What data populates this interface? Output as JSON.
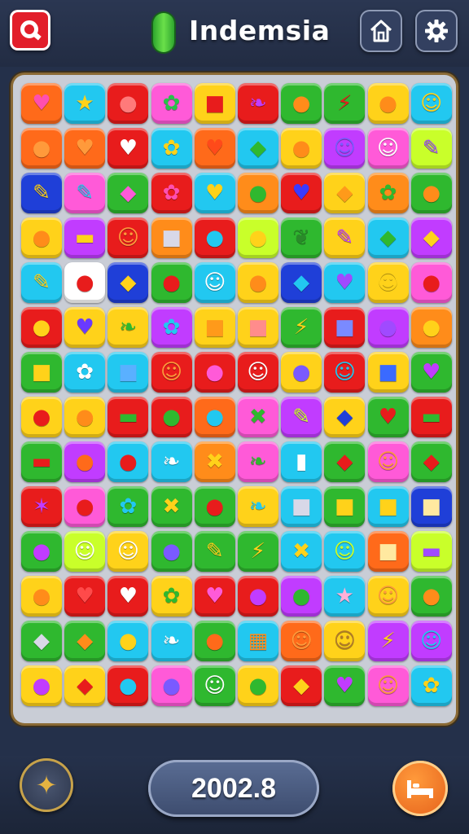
{
  "header": {
    "title": "Indemsia",
    "left_button_icon": "q-badge-icon",
    "pill_icon": "green-pill-icon",
    "home_icon": "home-icon",
    "settings_icon": "gear-icon"
  },
  "board": {
    "columns": 10,
    "rows": 14,
    "tiles": [
      [
        "#ff6a1a",
        "♥",
        "#ff4fb0"
      ],
      [
        "#22c8f0",
        "★",
        "#ffd21a"
      ],
      [
        "#e81c1c",
        "●",
        "#ff7a7a"
      ],
      [
        "#ff5ad8",
        "✿",
        "#29c24a"
      ],
      [
        "#ffd21a",
        "■",
        "#e81c1c"
      ],
      [
        "#e81c1c",
        "❧",
        "#c13cff"
      ],
      [
        "#2fb82f",
        "●",
        "#ff8c1a"
      ],
      [
        "#2fb82f",
        "⚡",
        "#e81c1c"
      ],
      [
        "#ffd21a",
        "●",
        "#ff8c1a"
      ],
      [
        "#22c8f0",
        "☺",
        "#ffd21a"
      ],
      [
        "#ff6a1a",
        "●",
        "#ff9a3b"
      ],
      [
        "#ff6a1a",
        "♥",
        "#ff9a3b"
      ],
      [
        "#e81c1c",
        "♥",
        "#ffffff"
      ],
      [
        "#22c8f0",
        "✿",
        "#ffd21a"
      ],
      [
        "#ff6a1a",
        "♥",
        "#ff4a1a"
      ],
      [
        "#22c8f0",
        "◆",
        "#2fb82f"
      ],
      [
        "#ffd21a",
        "●",
        "#ff8c1a"
      ],
      [
        "#c13cff",
        "☺",
        "#7a5aff"
      ],
      [
        "#ff5ad8",
        "☺",
        "#ffffff"
      ],
      [
        "#c9ff2a",
        "✎",
        "#a04aff"
      ],
      [
        "#1f3fd8",
        "✎",
        "#ffd21a"
      ],
      [
        "#ff5ad8",
        "✎",
        "#22c8f0"
      ],
      [
        "#2fb82f",
        "◆",
        "#ff5ad8"
      ],
      [
        "#e81c1c",
        "✿",
        "#ff4fb0"
      ],
      [
        "#22c8f0",
        "♥",
        "#ffd21a"
      ],
      [
        "#ff8c1a",
        "●",
        "#2fb82f"
      ],
      [
        "#e81c1c",
        "♥",
        "#3a3aff"
      ],
      [
        "#ffd21a",
        "◆",
        "#ff9a1a"
      ],
      [
        "#ff8c1a",
        "✿",
        "#2fb82f"
      ],
      [
        "#2fb82f",
        "●",
        "#ff8c1a"
      ],
      [
        "#ffd21a",
        "●",
        "#ff8c1a"
      ],
      [
        "#c13cff",
        "▬",
        "#ffd21a"
      ],
      [
        "#e81c1c",
        "☺",
        "#ff9a3b"
      ],
      [
        "#ff8c1a",
        "■",
        "#d8d8e8"
      ],
      [
        "#e81c1c",
        "●",
        "#22c8f0"
      ],
      [
        "#c9ff2a",
        "●",
        "#ffd21a"
      ],
      [
        "#2fb82f",
        "❦",
        "#2a8a2a"
      ],
      [
        "#ffd21a",
        "✎",
        "#c13cff"
      ],
      [
        "#22c8f0",
        "◆",
        "#2fb82f"
      ],
      [
        "#c13cff",
        "◆",
        "#ffd21a"
      ],
      [
        "#22c8f0",
        "✎",
        "#ffd21a"
      ],
      [
        "#ffffff",
        "●",
        "#e81c1c"
      ],
      [
        "#1f3fd8",
        "◆",
        "#ffd21a"
      ],
      [
        "#2fb82f",
        "●",
        "#e81c1c"
      ],
      [
        "#22c8f0",
        "☺",
        "#ffffff"
      ],
      [
        "#ffd21a",
        "●",
        "#ff8c1a"
      ],
      [
        "#1f3fd8",
        "◆",
        "#22c8f0"
      ],
      [
        "#22c8f0",
        "♥",
        "#a04aff"
      ],
      [
        "#ffd21a",
        "☺",
        "#ffd21a"
      ],
      [
        "#ff5ad8",
        "●",
        "#e81c1c"
      ],
      [
        "#e81c1c",
        "●",
        "#ffd21a"
      ],
      [
        "#ffd21a",
        "♥",
        "#6a3aff"
      ],
      [
        "#ffd21a",
        "❧",
        "#2fb82f"
      ],
      [
        "#c13cff",
        "✿",
        "#22c8f0"
      ],
      [
        "#ffd21a",
        "■",
        "#ff9a1a"
      ],
      [
        "#ffd21a",
        "■",
        "#ff8c8c"
      ],
      [
        "#2fb82f",
        "⚡",
        "#ffd21a"
      ],
      [
        "#e81c1c",
        "■",
        "#7a8aff"
      ],
      [
        "#c13cff",
        "●",
        "#a04aff"
      ],
      [
        "#ff8c1a",
        "●",
        "#ffd21a"
      ],
      [
        "#2fb82f",
        "■",
        "#ffd21a"
      ],
      [
        "#22c8f0",
        "✿",
        "#ffffff"
      ],
      [
        "#22c8f0",
        "■",
        "#5ab0ff"
      ],
      [
        "#e81c1c",
        "☺",
        "#ff9a3b"
      ],
      [
        "#e81c1c",
        "●",
        "#ff5ad8"
      ],
      [
        "#e81c1c",
        "☺",
        "#ffffff"
      ],
      [
        "#ffd21a",
        "●",
        "#7a5aff"
      ],
      [
        "#e81c1c",
        "☺",
        "#22c8f0"
      ],
      [
        "#ffd21a",
        "■",
        "#3a6aff"
      ],
      [
        "#2fb82f",
        "♥",
        "#c13cff"
      ],
      [
        "#ffd21a",
        "●",
        "#e81c1c"
      ],
      [
        "#ffd21a",
        "●",
        "#ff8c1a"
      ],
      [
        "#e81c1c",
        "▬",
        "#2fb82f"
      ],
      [
        "#e81c1c",
        "●",
        "#2fb82f"
      ],
      [
        "#ff6a1a",
        "●",
        "#22c8f0"
      ],
      [
        "#ff5ad8",
        "✖",
        "#2fb82f"
      ],
      [
        "#c13cff",
        "✎",
        "#c9ff2a"
      ],
      [
        "#ffd21a",
        "◆",
        "#1f3fd8"
      ],
      [
        "#2fb82f",
        "♥",
        "#e81c1c"
      ],
      [
        "#e81c1c",
        "▬",
        "#2fb82f"
      ],
      [
        "#2fb82f",
        "▬",
        "#e81c1c"
      ],
      [
        "#c13cff",
        "●",
        "#ff6a1a"
      ],
      [
        "#22c8f0",
        "●",
        "#e81c1c"
      ],
      [
        "#22c8f0",
        "❧",
        "#ffffff"
      ],
      [
        "#ff8c1a",
        "✖",
        "#ffd21a"
      ],
      [
        "#ff5ad8",
        "❧",
        "#2fb82f"
      ],
      [
        "#22c8f0",
        "▮",
        "#ffffff"
      ],
      [
        "#2fb82f",
        "◆",
        "#e81c1c"
      ],
      [
        "#ff5ad8",
        "☺",
        "#ff9a3b"
      ],
      [
        "#2fb82f",
        "◆",
        "#e81c1c"
      ],
      [
        "#e81c1c",
        "✶",
        "#c13cff"
      ],
      [
        "#ff5ad8",
        "●",
        "#e81c1c"
      ],
      [
        "#2fb82f",
        "✿",
        "#22c8f0"
      ],
      [
        "#2fb82f",
        "✖",
        "#ffd21a"
      ],
      [
        "#2fb82f",
        "●",
        "#e81c1c"
      ],
      [
        "#ffd21a",
        "❧",
        "#22c8f0"
      ],
      [
        "#22c8f0",
        "■",
        "#d8d8e8"
      ],
      [
        "#2fb82f",
        "■",
        "#ffd21a"
      ],
      [
        "#22c8f0",
        "■",
        "#ffd21a"
      ],
      [
        "#1f3fd8",
        "■",
        "#ffe9a0"
      ],
      [
        "#2fb82f",
        "●",
        "#c13cff"
      ],
      [
        "#c9ff2a",
        "☺",
        "#ffffff"
      ],
      [
        "#ffd21a",
        "☺",
        "#ffffff"
      ],
      [
        "#2fb82f",
        "●",
        "#7a5aff"
      ],
      [
        "#2fb82f",
        "✎",
        "#ffd21a"
      ],
      [
        "#2fb82f",
        "⚡",
        "#ffd21a"
      ],
      [
        "#22c8f0",
        "✖",
        "#ffd21a"
      ],
      [
        "#22c8f0",
        "☺",
        "#c9ff2a"
      ],
      [
        "#ff6a1a",
        "■",
        "#ffe9a0"
      ],
      [
        "#c9ff2a",
        "▬",
        "#a04aff"
      ],
      [
        "#ffd21a",
        "●",
        "#ff8c1a"
      ],
      [
        "#e81c1c",
        "♥",
        "#ff4a4a"
      ],
      [
        "#e81c1c",
        "♥",
        "#ffffff"
      ],
      [
        "#ffd21a",
        "✿",
        "#2fb82f"
      ],
      [
        "#e81c1c",
        "♥",
        "#ff5ad8"
      ],
      [
        "#e81c1c",
        "●",
        "#c13cff"
      ],
      [
        "#c13cff",
        "●",
        "#2fb82f"
      ],
      [
        "#22c8f0",
        "★",
        "#ffb0d8"
      ],
      [
        "#ffd21a",
        "☺",
        "#ff9a3b"
      ],
      [
        "#2fb82f",
        "●",
        "#ff8c1a"
      ],
      [
        "#2fb82f",
        "◆",
        "#d8d8e8"
      ],
      [
        "#2fb82f",
        "◆",
        "#ff8c1a"
      ],
      [
        "#22c8f0",
        "●",
        "#ffd21a"
      ],
      [
        "#22c8f0",
        "❧",
        "#ffffff"
      ],
      [
        "#2fb82f",
        "●",
        "#ff6a1a"
      ],
      [
        "#22c8f0",
        "▦",
        "#ff8c1a"
      ],
      [
        "#ff6a1a",
        "☺",
        "#ff9a3b"
      ],
      [
        "#ffd21a",
        "☺",
        "#b07a2a"
      ],
      [
        "#c13cff",
        "⚡",
        "#ffd21a"
      ],
      [
        "#c13cff",
        "☺",
        "#22c8f0"
      ],
      [
        "#ffd21a",
        "●",
        "#c13cff"
      ],
      [
        "#ffd21a",
        "◆",
        "#e81c1c"
      ],
      [
        "#e81c1c",
        "●",
        "#22c8f0"
      ],
      [
        "#ff5ad8",
        "●",
        "#7a5aff"
      ],
      [
        "#2fb82f",
        "☺",
        "#ffffff"
      ],
      [
        "#ffd21a",
        "●",
        "#2fb82f"
      ],
      [
        "#e81c1c",
        "◆",
        "#ffd21a"
      ],
      [
        "#2fb82f",
        "♥",
        "#c13cff"
      ],
      [
        "#ff5ad8",
        "☺",
        "#ff9a3b"
      ],
      [
        "#22c8f0",
        "✿",
        "#ffd21a"
      ]
    ]
  },
  "footer": {
    "left_button_icon": "gold-emblem-icon",
    "score": "2002.8",
    "right_button_icon": "bed-icon"
  }
}
